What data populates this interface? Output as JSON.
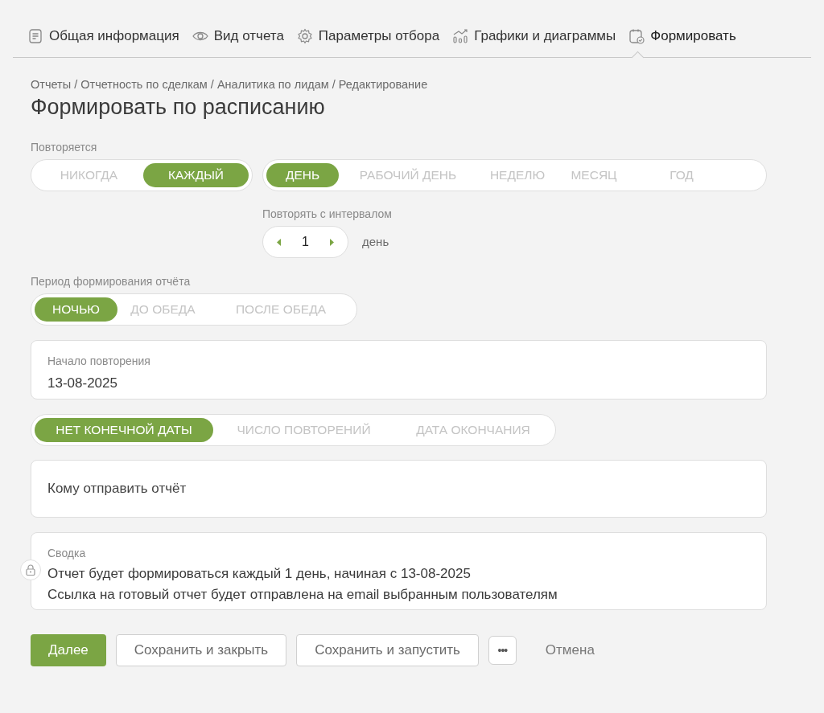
{
  "tabs": [
    {
      "label": "Общая информация",
      "selected": false
    },
    {
      "label": "Вид отчета",
      "selected": false
    },
    {
      "label": "Параметры отбора",
      "selected": false
    },
    {
      "label": "Графики и диаграммы",
      "selected": false
    },
    {
      "label": "Формировать",
      "selected": true
    }
  ],
  "breadcrumb": "Отчеты / Отчетность по сделкам / Аналитика по лидам / Редактирование",
  "title": "Формировать по расписанию",
  "repeat": {
    "label": "Повторяется",
    "groups": [
      [
        {
          "label": "НИКОГДА",
          "selected": false
        },
        {
          "label": "КАЖДЫЙ",
          "selected": true
        }
      ],
      [
        {
          "label": "ДЕНЬ",
          "selected": true
        },
        {
          "label": "РАБОЧИЙ ДЕНЬ",
          "selected": false
        },
        {
          "label": "НЕДЕЛЮ",
          "selected": false
        },
        {
          "label": "МЕСЯЦ",
          "selected": false
        },
        {
          "label": "ГОД",
          "selected": false
        }
      ]
    ]
  },
  "interval": {
    "label": "Повторять с интервалом",
    "value": "1",
    "unit": "день"
  },
  "period": {
    "label": "Период формирования отчёта",
    "options": [
      {
        "label": "НОЧЬЮ",
        "selected": true
      },
      {
        "label": "ДО ОБЕДА",
        "selected": false
      },
      {
        "label": "ПОСЛЕ ОБЕДА",
        "selected": false
      }
    ]
  },
  "start": {
    "label": "Начало повторения",
    "value": "13-08-2025"
  },
  "end_options": [
    {
      "label": "НЕТ КОНЕЧНОЙ ДАТЫ",
      "selected": true
    },
    {
      "label": "ЧИСЛО ПОВТОРЕНИЙ",
      "selected": false
    },
    {
      "label": "ДАТА ОКОНЧАНИЯ",
      "selected": false
    }
  ],
  "recipients": {
    "placeholder": "Кому отправить отчёт"
  },
  "summary": {
    "label": "Сводка",
    "lines": [
      "Отчет будет формироваться каждый 1 день, начиная с 13-08-2025",
      "Ссылка на готовый отчет будет отправлена на email выбранным пользователям"
    ]
  },
  "buttons": [
    {
      "label": "Далее",
      "kind": "primary"
    },
    {
      "label": "Сохранить и закрыть",
      "kind": "secondary"
    },
    {
      "label": "Сохранить и запустить",
      "kind": "secondary"
    },
    {
      "label": "•••",
      "kind": "more"
    },
    {
      "label": "Отмена",
      "kind": "link"
    }
  ]
}
